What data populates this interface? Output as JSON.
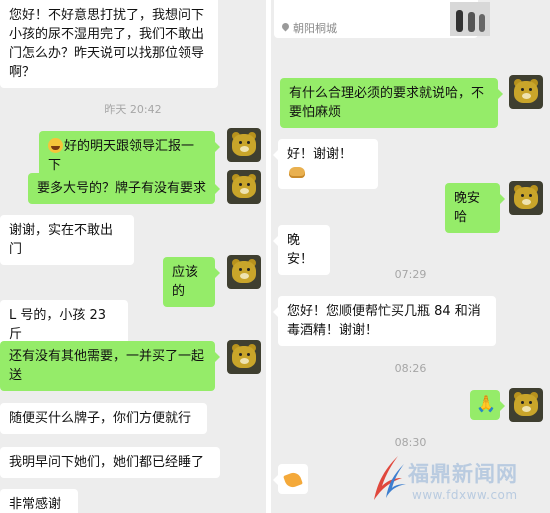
{
  "left": {
    "messages": [
      {
        "id": "l1",
        "text": "您好！不好意思打扰了，我想问下小孩的尿不湿用完了，我们不敢出门怎么办？昨天说可以找那位领导啊？"
      },
      {
        "id": "l2",
        "text": "好的明天跟领导汇报一下"
      },
      {
        "id": "l3",
        "text": "要多大号的？牌子有没有要求"
      },
      {
        "id": "l4",
        "text": "谢谢，实在不敢出门"
      },
      {
        "id": "l5",
        "text": "应该的"
      },
      {
        "id": "l6",
        "text": "L 号的，小孩 23 斤"
      },
      {
        "id": "l7",
        "text": "还有没有其他需要，一并买了一起送"
      },
      {
        "id": "l8",
        "text": "随便买什么牌子，你们方便就行"
      },
      {
        "id": "l9",
        "text": "我明早问下她们，她们都已经睡了"
      },
      {
        "id": "l10",
        "text": "非常感谢"
      }
    ],
    "timestamp": "昨天 20:42"
  },
  "right": {
    "location_tag": "朝阳桐城",
    "messages": [
      {
        "id": "r1",
        "text": "有什么合理必须的要求就说哈，不要怕麻烦"
      },
      {
        "id": "r2",
        "text": "好！谢谢！"
      },
      {
        "id": "r3",
        "text": "晚安哈"
      },
      {
        "id": "r4",
        "text": "晚安！"
      },
      {
        "id": "r5",
        "text": "您好！您顺便帮忙买几瓶 84 和消毒酒精！谢谢！"
      }
    ],
    "timestamps": [
      "07:29",
      "08:26",
      "08:30"
    ]
  },
  "watermark": {
    "title": "福鼎新闻网",
    "url": "www.fdxww.com"
  },
  "icons": {
    "avatar": "bear-avatar-icon",
    "laugh": "laughing-face-icon",
    "bread": "bread-icon",
    "hands": "folded-hands-icon",
    "location": "location-pin-icon"
  },
  "colors": {
    "chat_bg": "#ededed",
    "incoming_bubble": "#ffffff",
    "outgoing_bubble": "#95ec69",
    "timestamp": "#a6a6a6"
  }
}
